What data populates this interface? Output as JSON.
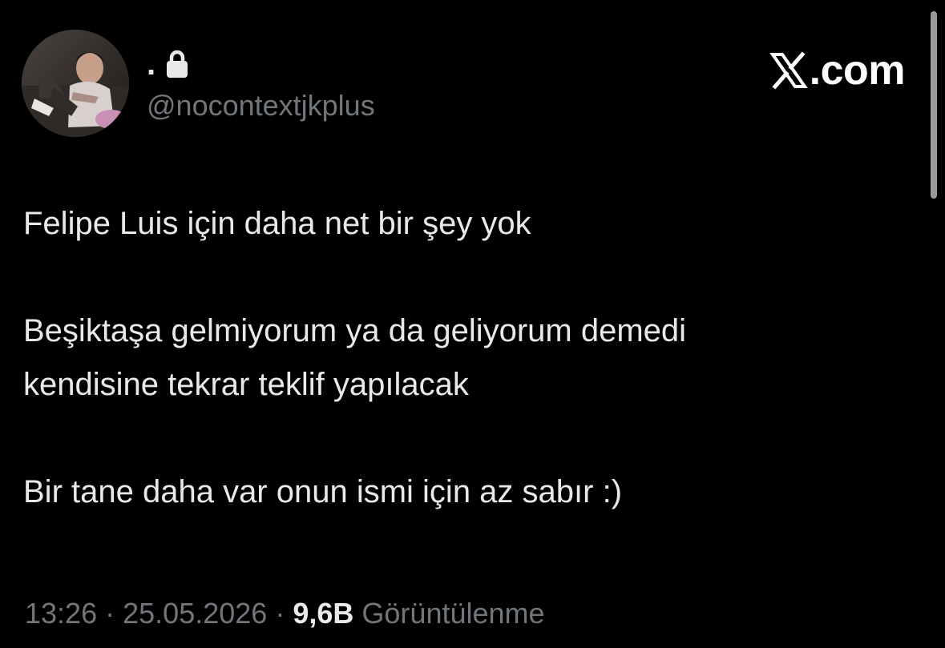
{
  "author": {
    "display_name": ".",
    "handle": "@nocontextjkplus",
    "protected_icon": "lock-icon",
    "avatar": "profile-photo"
  },
  "brand": {
    "icon": "x-logo-icon",
    "text": ".com"
  },
  "tweet": {
    "lines": [
      "Felipe Luis için daha net bir şey yok",
      "Beşiktaşa gelmiyorum ya da geliyorum demedi",
      "kendisine tekrar teklif yapılacak",
      "Bir tane daha var onun ismi için az sabır :)"
    ]
  },
  "meta": {
    "time": "13:26",
    "separator": "·",
    "date": "25.05.2026",
    "views_count": "9,6B",
    "views_label": "Görüntülenme"
  },
  "colors": {
    "background": "#000000",
    "primary_text": "#e7e9ea",
    "secondary_text": "#71767b"
  }
}
